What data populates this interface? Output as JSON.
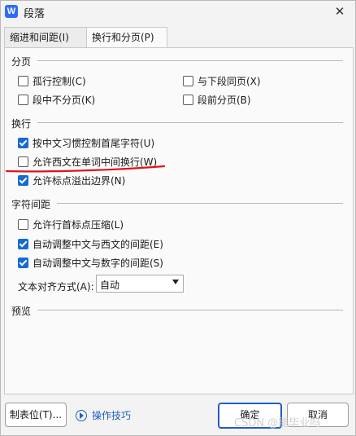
{
  "window": {
    "app_icon": "W",
    "title": "段落",
    "close_symbol": "✕"
  },
  "tabs": [
    {
      "label": "缩进和间距(I)",
      "active": false
    },
    {
      "label": "换行和分页(P)",
      "active": true
    }
  ],
  "pagination": {
    "title": "分页",
    "options": [
      {
        "label": "孤行控制(C)",
        "checked": false
      },
      {
        "label": "与下段同页(X)",
        "checked": false
      },
      {
        "label": "段中不分页(K)",
        "checked": false
      },
      {
        "label": "段前分页(B)",
        "checked": false
      }
    ]
  },
  "line_break": {
    "title": "换行",
    "options": [
      {
        "label": "按中文习惯控制首尾字符(U)",
        "checked": true
      },
      {
        "label": "允许西文在单词中间换行(W)",
        "checked": false
      },
      {
        "label": "允许标点溢出边界(N)",
        "checked": true
      }
    ]
  },
  "char_spacing": {
    "title": "字符间距",
    "options": [
      {
        "label": "允许行首标点压缩(L)",
        "checked": false
      },
      {
        "label": "自动调整中文与西文的间距(E)",
        "checked": true
      },
      {
        "label": "自动调整中文与数字的间距(S)",
        "checked": true
      }
    ],
    "align_label": "文本对齐方式(A):",
    "align_value": "自动"
  },
  "preview": {
    "title": "预览"
  },
  "footer": {
    "tabstop_label": "制表位(T)...",
    "tips_label": "操作技巧",
    "ok_label": "确定",
    "cancel_label": "取消"
  },
  "watermark": "CSDN @能毕业吗",
  "colors": {
    "accent": "#1769d6",
    "annotation": "#e0141e"
  }
}
